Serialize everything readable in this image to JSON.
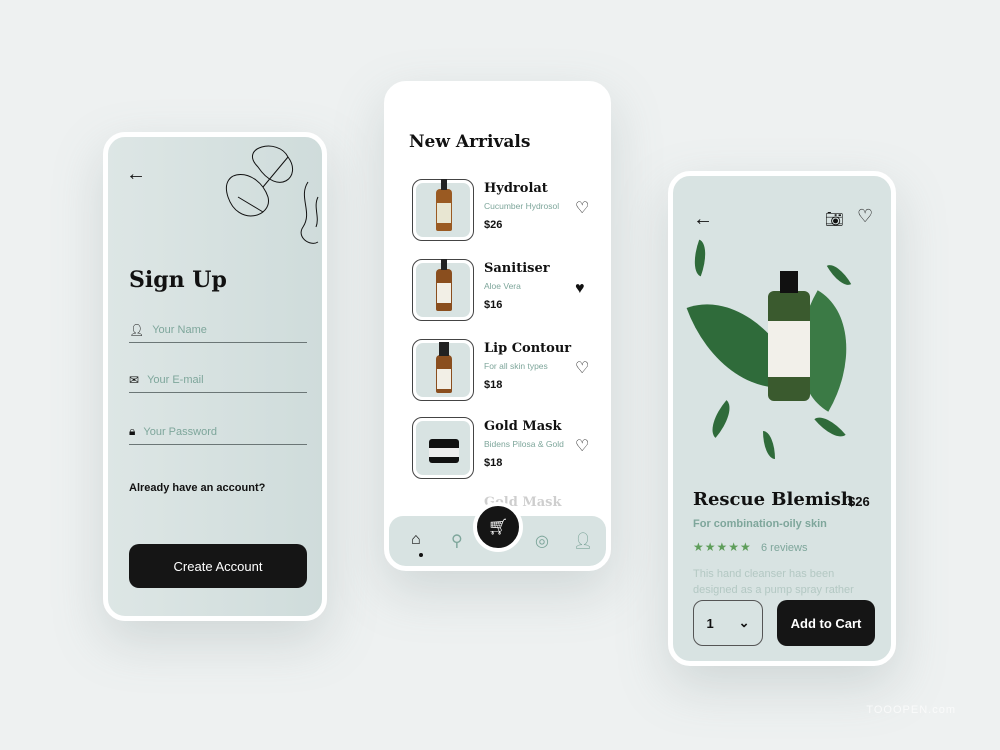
{
  "signup": {
    "title": "Sign Up",
    "fields": [
      {
        "icon": "user-icon",
        "placeholder": "Your Name"
      },
      {
        "icon": "mail-icon",
        "placeholder": "Your E-mail"
      },
      {
        "icon": "lock-icon",
        "placeholder": "Your Password"
      }
    ],
    "login_prompt": "Already have an account?",
    "create_button": "Create Account"
  },
  "arrivals": {
    "title": "New Arrivals",
    "items": [
      {
        "name": "Hydrolat",
        "sub": "Cucumber Hydrosol",
        "price": "$26",
        "favorite": false
      },
      {
        "name": "Sanitiser",
        "sub": "Aloe Vera",
        "price": "$16",
        "favorite": true
      },
      {
        "name": "Lip Contour",
        "sub": "For all skin types",
        "price": "$18",
        "favorite": false
      },
      {
        "name": "Gold Mask",
        "sub": "Bidens Pilosa & Gold",
        "price": "$18",
        "favorite": false
      },
      {
        "name": "Gold Mask"
      }
    ],
    "nav": [
      "home-icon",
      "search-icon",
      "cart-icon",
      "mirror-icon",
      "profile-icon"
    ],
    "active_nav": "home"
  },
  "product": {
    "name": "Rescue Blemish",
    "price": "$26",
    "sub": "For combination-oily skin",
    "rating": 5,
    "stars": "★★★★★",
    "reviews": "6 reviews",
    "description": "This hand cleanser has been designed as a pump spray rather",
    "quantity": "1",
    "add_button": "Add to Cart"
  },
  "colors": {
    "accent": "#7ea69b",
    "stars": "#5e9e5a",
    "dark": "#151515",
    "panel": "#d8e3e2"
  },
  "watermark": "TOOOPEN.com"
}
